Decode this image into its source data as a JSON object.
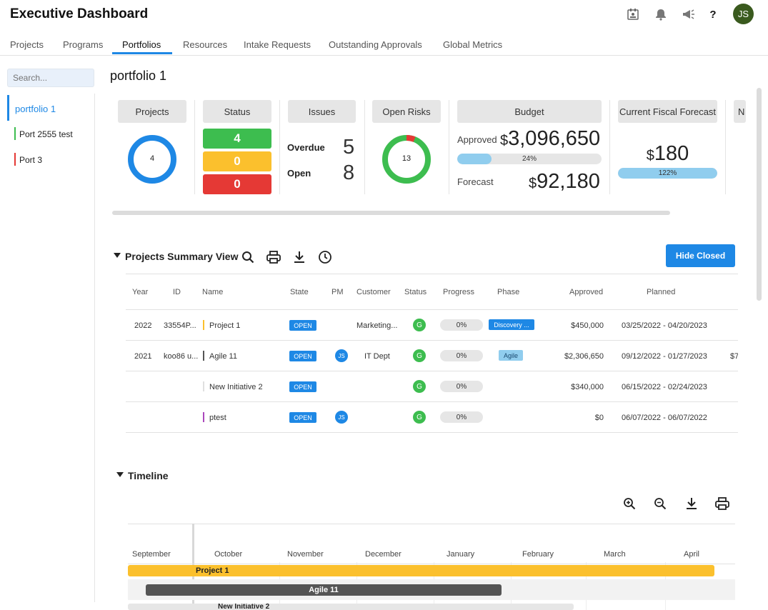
{
  "app": {
    "title": "Executive Dashboard"
  },
  "header": {
    "icons": [
      "calendar-icon",
      "bell-icon",
      "megaphone-icon",
      "help-icon"
    ],
    "help_glyph": "?",
    "avatar": "JS"
  },
  "tabs": [
    {
      "label": "Projects",
      "active": false
    },
    {
      "label": "Programs",
      "active": false
    },
    {
      "label": "Portfolios",
      "active": true
    },
    {
      "label": "Resources",
      "active": false
    },
    {
      "label": "Intake Requests",
      "active": false
    },
    {
      "label": "Outstanding Approvals",
      "active": false
    },
    {
      "label": "Global Metrics",
      "active": false
    }
  ],
  "sidebar": {
    "search_placeholder": "Search...",
    "items": [
      {
        "label": "portfolio 1",
        "color": "#1e88e5",
        "selected": true
      },
      {
        "label": "Port 2555 test",
        "color": "#3dbd4f",
        "selected": false
      },
      {
        "label": "Port 3",
        "color": "#e53935",
        "selected": false
      }
    ]
  },
  "portfolio": {
    "title": "portfolio 1",
    "cards": {
      "projects": {
        "label": "Projects",
        "count": "4"
      },
      "status": {
        "label": "Status",
        "green": "4",
        "yellow": "0",
        "red": "0"
      },
      "issues": {
        "label": "Issues",
        "overdue_label": "Overdue",
        "overdue": "5",
        "open_label": "Open",
        "open": "8"
      },
      "risks": {
        "label": "Open Risks",
        "count": "13",
        "red_fraction": 0.06
      },
      "budget": {
        "label": "Budget",
        "approved_label": "Approved",
        "currency": "$",
        "approved": "3,096,650",
        "approved_pct": "24%",
        "approved_fill": 0.24,
        "forecast_label": "Forecast",
        "forecast": "92,180"
      },
      "fiscal": {
        "label": "Current Fiscal Forecast",
        "currency": "$",
        "value": "180",
        "pct": "122%",
        "fill": 1.0
      },
      "next": {
        "label": "N"
      }
    }
  },
  "summary": {
    "title": "Projects Summary View",
    "hide_closed": "Hide Closed",
    "columns": [
      "Year",
      "ID",
      "Name",
      "State",
      "PM",
      "Customer",
      "Status",
      "Progress",
      "Phase",
      "Approved",
      "Planned"
    ],
    "rows": [
      {
        "year": "2022",
        "id": "33554P...",
        "name": "Project 1",
        "bar": "#fbc02d",
        "state": "OPEN",
        "pm": "",
        "customer": "Marketing...",
        "status": "G",
        "progress": "0%",
        "phase": "Discovery ...",
        "phase_style": "dark",
        "approved": "$450,000",
        "planned": "03/25/2022 - 04/20/2023",
        "extra": ""
      },
      {
        "year": "2021",
        "id": "koo86 u...",
        "name": "Agile 11",
        "bar": "#555555",
        "state": "OPEN",
        "pm": "JS",
        "customer": "IT Dept",
        "status": "G",
        "progress": "0%",
        "phase": "Agile",
        "phase_style": "light",
        "approved": "$2,306,650",
        "planned": "09/12/2022 - 01/27/2023",
        "extra": "$7"
      },
      {
        "year": "",
        "id": "",
        "name": "New Initiative 2",
        "bar": "#e0e0e0",
        "state": "OPEN",
        "pm": "",
        "customer": "",
        "status": "G",
        "progress": "0%",
        "phase": "",
        "phase_style": "",
        "approved": "$340,000",
        "planned": "06/15/2022 - 02/24/2023",
        "extra": ""
      },
      {
        "year": "",
        "id": "",
        "name": "ptest",
        "bar": "#ab47bc",
        "state": "OPEN",
        "pm": "JS",
        "customer": "",
        "status": "G",
        "progress": "0%",
        "phase": "",
        "phase_style": "",
        "approved": "$0",
        "planned": "06/07/2022 - 06/07/2022",
        "extra": ""
      }
    ]
  },
  "timeline": {
    "title": "Timeline",
    "months": [
      "September",
      "October",
      "November",
      "December",
      "January",
      "February",
      "March",
      "April"
    ],
    "bars": [
      {
        "label": "Project 1",
        "color": "#fbc02d",
        "text_color": "#222"
      },
      {
        "label": "Agile 11",
        "color": "#555555",
        "text_color": "#fff"
      },
      {
        "label": "New Initiative 2",
        "color": "#e6e6e6",
        "text_color": "#222"
      }
    ]
  },
  "colors": {
    "accent": "#1e88e5",
    "green": "#3dbd4f",
    "yellow": "#fbc02d",
    "red": "#e53935"
  }
}
